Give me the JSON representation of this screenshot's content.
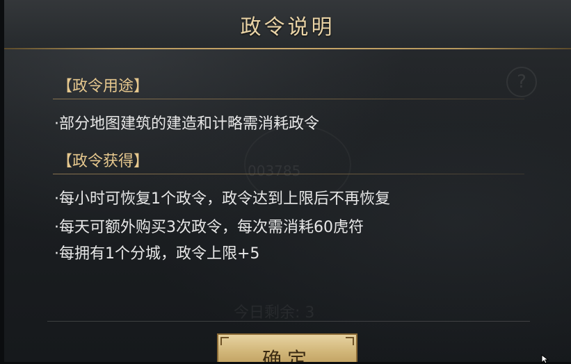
{
  "dialog": {
    "title": "政令说明",
    "help_icon": "question-icon",
    "seal_text": "003785",
    "sections": [
      {
        "header": "【政令用途】",
        "lines": [
          "·部分地图建筑的建造和计略需消耗政令"
        ]
      },
      {
        "header": "【政令获得】",
        "lines": [
          "·每小时可恢复1个政令，政令达到上限后不再恢复",
          "·每天可额外购买3次政令，每次需消耗60虎符",
          "·每拥有1个分城，政令上限+5"
        ]
      }
    ],
    "remaining_text": "今日剩余: 3",
    "confirm_label": "确定"
  },
  "colors": {
    "title": "#e9d3a6",
    "section_header": "#e6c88e",
    "body_text": "#e8e8e8",
    "button_gold": "#d2b77a",
    "accent_line": "#caa86a"
  }
}
